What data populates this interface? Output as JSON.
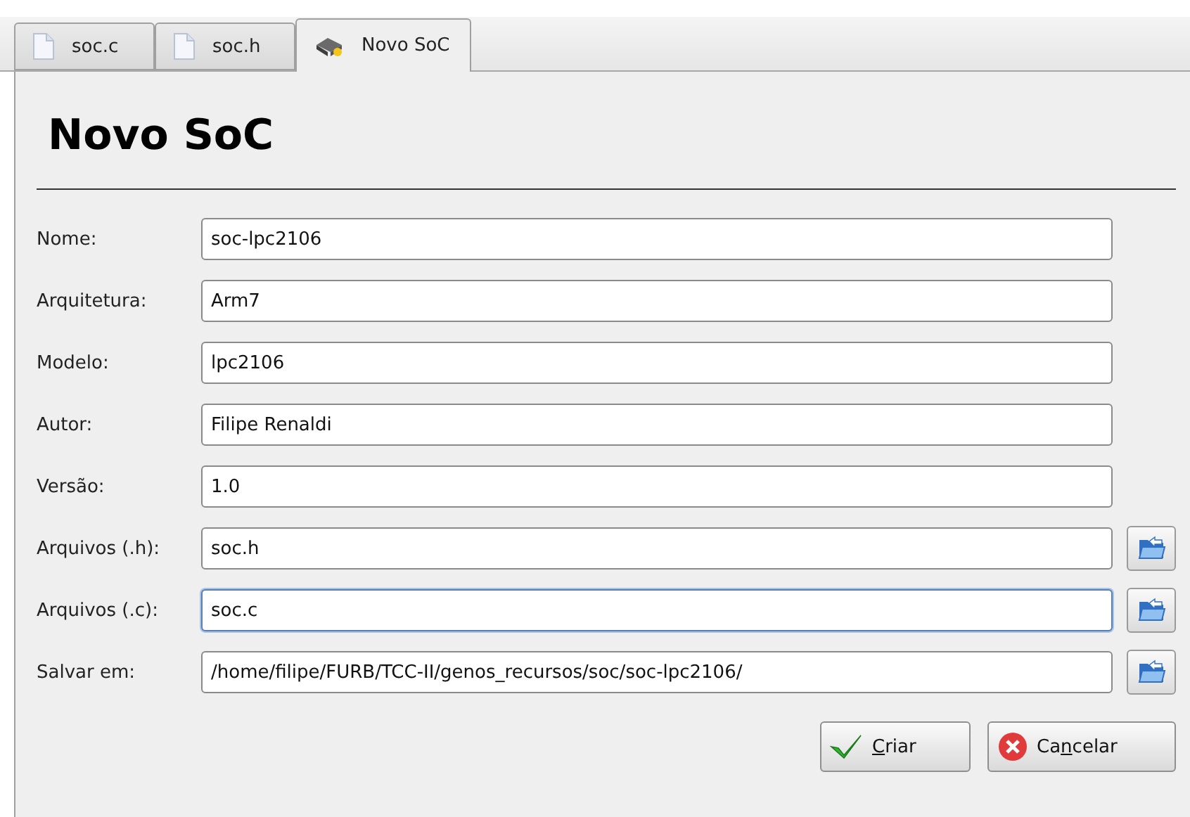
{
  "tabs": [
    {
      "label": "soc.c",
      "kind": "file",
      "selected": false
    },
    {
      "label": "soc.h",
      "kind": "file",
      "selected": false
    },
    {
      "label": "Novo SoC",
      "kind": "device",
      "selected": true
    }
  ],
  "heading": "Novo SoC",
  "fields": [
    {
      "label": "Nome:",
      "value": "soc-lpc2106",
      "focused": false,
      "browse": false
    },
    {
      "label": "Arquitetura:",
      "value": "Arm7",
      "focused": false,
      "browse": false
    },
    {
      "label": "Modelo:",
      "value": "lpc2106",
      "focused": false,
      "browse": false
    },
    {
      "label": "Autor:",
      "value": "Filipe Renaldi",
      "focused": false,
      "browse": false
    },
    {
      "label": "Versão:",
      "value": "1.0",
      "focused": false,
      "browse": false
    },
    {
      "label": "Arquivos (.h):",
      "value": "soc.h",
      "focused": false,
      "browse": true
    },
    {
      "label": "Arquivos (.c):",
      "value": "soc.c",
      "focused": true,
      "browse": true
    },
    {
      "label": "Salvar em:",
      "value": "/home/filipe/FURB/TCC-II/genos_recursos/soc/soc-lpc2106/",
      "focused": false,
      "browse": true
    }
  ],
  "buttons": [
    {
      "kind": "confirm",
      "mnemonic": "C",
      "after": "riar"
    },
    {
      "kind": "cancel",
      "before": "Ca",
      "mnemonic": "n",
      "after": "celar"
    }
  ]
}
